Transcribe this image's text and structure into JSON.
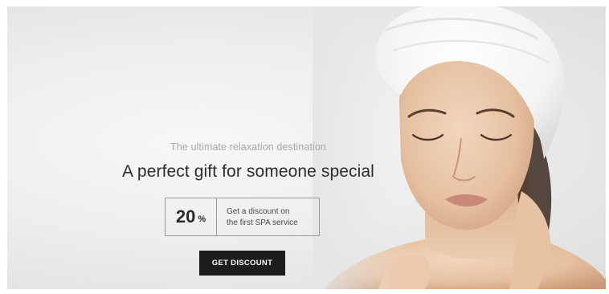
{
  "hero": {
    "subtitle": "The ultimate relaxation destination",
    "headline": "A perfect gift for someone special",
    "offer": {
      "value": "20",
      "unit": "%",
      "line1": "Get a discount on",
      "line2": "the first SPA service"
    },
    "cta_label": "GET DISCOUNT",
    "photo": "woman-in-towel-turban"
  },
  "colors": {
    "background": "#e9e9e9",
    "button": "#1d1d1d",
    "button_text": "#ffffff",
    "headline": "#2d2d2d",
    "subtitle": "#a8a8a8",
    "skin": "#e9c6a8",
    "towel": "#f8f8f8"
  }
}
